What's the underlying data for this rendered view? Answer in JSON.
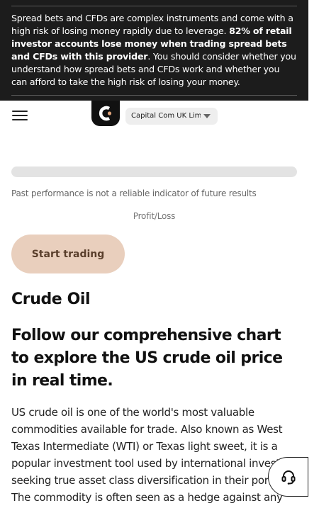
{
  "risk_warning": {
    "part1": "Spread bets and CFDs are complex instruments and come with a high risk of losing money rapidly due to leverage. ",
    "bold": "82% of retail investor accounts lose money when trading spread bets and CFDs with this provider",
    "part2": ". You should consider whether you understand how spread bets and CFDs work and whether you can afford to take the high risk of losing your money."
  },
  "header": {
    "menu_icon": "hamburger-menu-icon",
    "logo_icon": "capital-com-logo",
    "entity_selector": "Capital Com UK Lim..."
  },
  "chart": {
    "disclaimer": "Past performance is not a reliable indicator of future results",
    "profit_loss_label": "Profit/Loss"
  },
  "cta": {
    "start_trading": "Start trading"
  },
  "content": {
    "title": "Crude Oil",
    "tagline": "Follow our comprehensive chart to explore the US crude oil price in real time.",
    "body": "US crude oil is one of the world's most valuable commodities available for trade. Also known as West Texas Intermediate (WTI) or Texas light sweet, it is a popular investment tool used by international investors seeking true asset class diversification in their portfolio. The commodity is often seen as a hedge against any"
  },
  "support": {
    "icon": "headset-icon"
  },
  "colors": {
    "banner_bg": "#1c1c1c",
    "cta_bg": "#e9cfbd",
    "cta_text": "#5a3f2c",
    "logo_accent": "#e0a47a"
  }
}
